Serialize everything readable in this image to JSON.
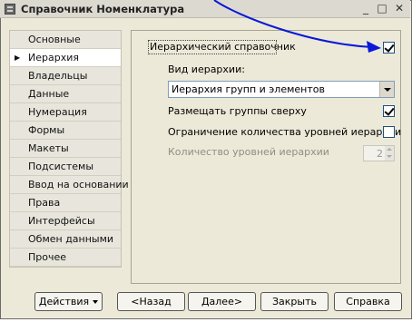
{
  "window": {
    "title": "Справочник Номенклатура",
    "controls": {
      "minimize": "_",
      "maximize": "□",
      "close": "✕"
    }
  },
  "tabs": [
    {
      "label": "Основные",
      "active": false
    },
    {
      "label": "Иерархия",
      "active": true
    },
    {
      "label": "Владельцы",
      "active": false
    },
    {
      "label": "Данные",
      "active": false
    },
    {
      "label": "Нумерация",
      "active": false
    },
    {
      "label": "Формы",
      "active": false
    },
    {
      "label": "Макеты",
      "active": false
    },
    {
      "label": "Подсистемы",
      "active": false
    },
    {
      "label": "Ввод на основании",
      "active": false
    },
    {
      "label": "Права",
      "active": false
    },
    {
      "label": "Интерфейсы",
      "active": false
    },
    {
      "label": "Обмен данными",
      "active": false
    },
    {
      "label": "Прочее",
      "active": false
    }
  ],
  "hierarchy": {
    "hierarchical_label": "Иерархический справочник",
    "hierarchical_checked": true,
    "type_label": "Вид иерархии:",
    "type_value": "Иерархия групп и элементов",
    "groups_on_top_label": "Размещать группы сверху",
    "groups_on_top_checked": true,
    "limit_levels_label": "Ограничение количества уровней иерархии",
    "limit_levels_checked": false,
    "levels_count_label": "Количество уровней иерархии",
    "levels_count_value": "2"
  },
  "buttons": {
    "actions": "Действия",
    "back": "<Назад",
    "next": "Далее>",
    "close": "Закрыть",
    "help": "Справка"
  },
  "colors": {
    "annotation_arrow": "#0a18d8",
    "window_bg": "#ece9d8"
  },
  "icons": {
    "active_tab_marker": "▶"
  }
}
